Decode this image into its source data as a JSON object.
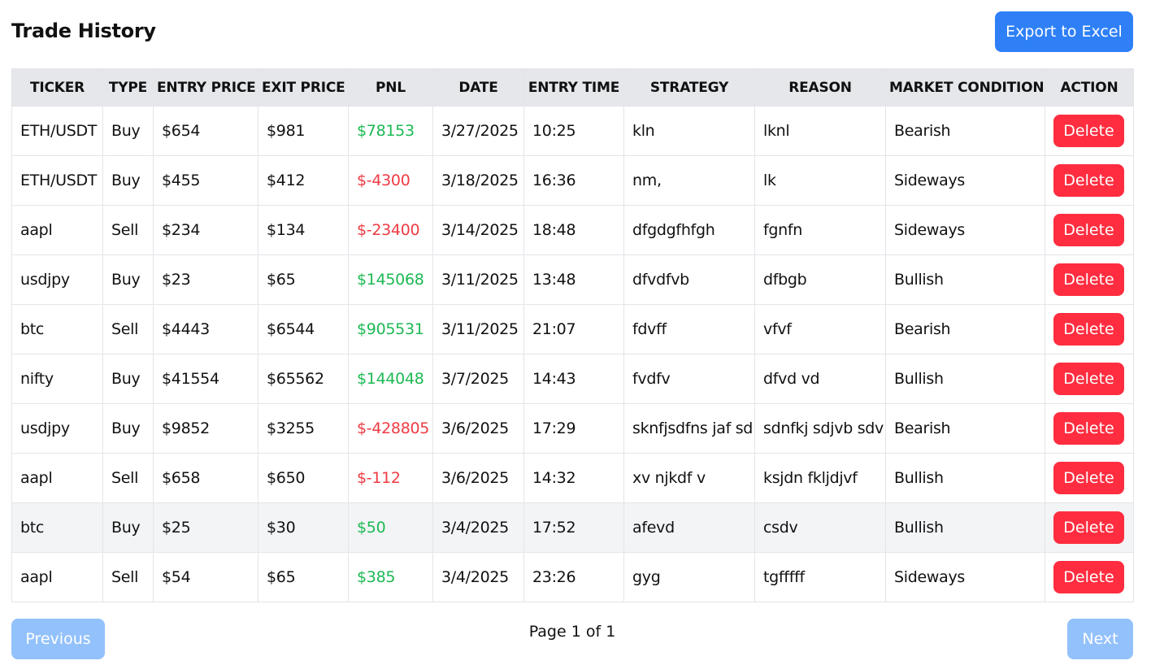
{
  "header": {
    "title": "Trade History",
    "export_label": "Export to Excel"
  },
  "table": {
    "columns": [
      "TICKER",
      "TYPE",
      "ENTRY PRICE",
      "EXIT PRICE",
      "PNL",
      "DATE",
      "ENTRY TIME",
      "STRATEGY",
      "REASON",
      "MARKET CONDITION",
      "ACTION"
    ],
    "rows": [
      {
        "ticker": "ETH/USDT",
        "type": "Buy",
        "entry": "$654",
        "exit": "$981",
        "pnl": "$78153",
        "pnl_sign": "pos",
        "date": "3/27/2025",
        "time": "10:25",
        "strategy": "kln",
        "reason": "lknl",
        "market": "Bearish",
        "action": "Delete"
      },
      {
        "ticker": "ETH/USDT",
        "type": "Buy",
        "entry": "$455",
        "exit": "$412",
        "pnl": "$-4300",
        "pnl_sign": "neg",
        "date": "3/18/2025",
        "time": "16:36",
        "strategy": "nm,",
        "reason": "lk",
        "market": "Sideways",
        "action": "Delete"
      },
      {
        "ticker": "aapl",
        "type": "Sell",
        "entry": "$234",
        "exit": "$134",
        "pnl": "$-23400",
        "pnl_sign": "neg",
        "date": "3/14/2025",
        "time": "18:48",
        "strategy": "dfgdgfhfgh",
        "reason": "fgnfn",
        "market": "Sideways",
        "action": "Delete"
      },
      {
        "ticker": "usdjpy",
        "type": "Buy",
        "entry": "$23",
        "exit": "$65",
        "pnl": "$145068",
        "pnl_sign": "pos",
        "date": "3/11/2025",
        "time": "13:48",
        "strategy": "dfvdfvb",
        "reason": "dfbgb",
        "market": "Bullish",
        "action": "Delete"
      },
      {
        "ticker": "btc",
        "type": "Sell",
        "entry": "$4443",
        "exit": "$6544",
        "pnl": "$905531",
        "pnl_sign": "pos",
        "date": "3/11/2025",
        "time": "21:07",
        "strategy": "fdvff",
        "reason": "vfvf",
        "market": "Bearish",
        "action": "Delete"
      },
      {
        "ticker": "nifty",
        "type": "Buy",
        "entry": "$41554",
        "exit": "$65562",
        "pnl": "$144048",
        "pnl_sign": "pos",
        "date": "3/7/2025",
        "time": "14:43",
        "strategy": "fvdfv",
        "reason": "dfvd vd",
        "market": "Bullish",
        "action": "Delete"
      },
      {
        "ticker": "usdjpy",
        "type": "Buy",
        "entry": "$9852",
        "exit": "$3255",
        "pnl": "$-428805",
        "pnl_sign": "neg",
        "date": "3/6/2025",
        "time": "17:29",
        "strategy": "sknfjsdfns jaf sd",
        "reason": "sdnfkj sdjvb sdv",
        "market": "Bearish",
        "action": "Delete"
      },
      {
        "ticker": "aapl",
        "type": "Sell",
        "entry": "$658",
        "exit": "$650",
        "pnl": "$-112",
        "pnl_sign": "neg",
        "date": "3/6/2025",
        "time": "14:32",
        "strategy": "xv njkdf v",
        "reason": "ksjdn fkljdjvf",
        "market": "Bullish",
        "action": "Delete"
      },
      {
        "ticker": "btc",
        "type": "Buy",
        "entry": "$25",
        "exit": "$30",
        "pnl": "$50",
        "pnl_sign": "pos",
        "date": "3/4/2025",
        "time": "17:52",
        "strategy": "afevd",
        "reason": "csdv",
        "market": "Bullish",
        "action": "Delete",
        "hover": true
      },
      {
        "ticker": "aapl",
        "type": "Sell",
        "entry": "$54",
        "exit": "$65",
        "pnl": "$385",
        "pnl_sign": "pos",
        "date": "3/4/2025",
        "time": "23:26",
        "strategy": "gyg",
        "reason": "tgfffff",
        "market": "Sideways",
        "action": "Delete"
      }
    ]
  },
  "pagination": {
    "previous_label": "Previous",
    "page_info": "Page 1 of 1",
    "next_label": "Next"
  },
  "colors": {
    "primary": "#2f80f7",
    "primary_disabled": "#93c1fb",
    "danger": "#ff2d3f",
    "profit": "#1db954",
    "loss": "#ef3b43",
    "header_bg": "#e5e7eb"
  }
}
